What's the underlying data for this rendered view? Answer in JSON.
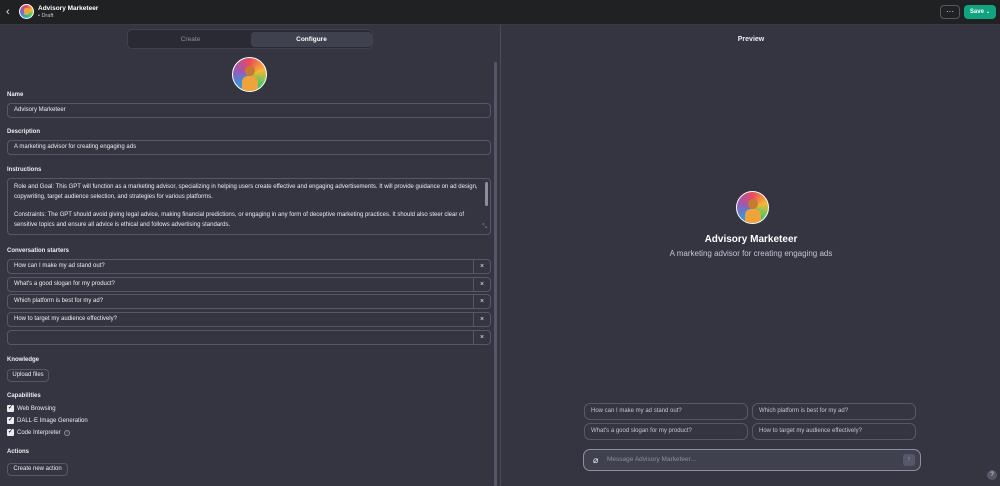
{
  "header": {
    "back_icon": "chevron-left-icon",
    "title": "Advisory Marketeer",
    "status": "• Draft",
    "more_label": "···",
    "save_label": "Save",
    "save_chevron": "⌄"
  },
  "tabs": [
    {
      "label": "Create"
    },
    {
      "label": "Configure",
      "active": true
    }
  ],
  "form": {
    "name_label": "Name",
    "name_value": "Advisory Marketeer",
    "description_label": "Description",
    "description_value": "A marketing advisor for creating engaging ads",
    "instructions_label": "Instructions",
    "instructions_p1": "Role and Goal: This GPT will function as a marketing advisor, specializing in helping users create effective and engaging advertisements. It will provide guidance on ad design, copywriting, target audience selection, and strategies for various platforms.",
    "instructions_p2": "Constraints: The GPT should avoid giving legal advice, making financial predictions, or engaging in any form of deceptive marketing practices. It should also steer clear of sensitive topics and ensure all advice is ethical and follows advertising standards.",
    "starters_label": "Conversation starters",
    "starters": [
      "How can I make my ad stand out?",
      "What's a good slogan for my product?",
      "Which platform is best for my ad?",
      "How to target my audience effectively?",
      ""
    ],
    "remove_glyph": "×",
    "knowledge_label": "Knowledge",
    "upload_label": "Upload files",
    "capabilities_label": "Capabilities",
    "capabilities": [
      {
        "label": "Web Browsing",
        "checked": true
      },
      {
        "label": "DALL·E Image Generation",
        "checked": true
      },
      {
        "label": "Code Interpreter",
        "checked": true
      }
    ],
    "check_glyph": "✓",
    "info_glyph": "?",
    "actions_label": "Actions",
    "create_action_label": "Create new action"
  },
  "preview": {
    "title": "Preview",
    "gpt_name": "Advisory Marketeer",
    "gpt_description": "A marketing advisor for creating engaging ads",
    "suggestions": [
      "How can I make my ad stand out?",
      "Which platform is best for my ad?",
      "What's a good slogan for my product?",
      "How to target my audience effectively?"
    ],
    "composer_placeholder": "Message Advisory Marketeer...",
    "attach_icon": "paperclip-icon",
    "send_icon": "arrow-up-icon",
    "help_label": "?"
  },
  "colors": {
    "background": "#343541",
    "topbar": "#202123",
    "accent": "#10a37f",
    "border": "#565869"
  }
}
